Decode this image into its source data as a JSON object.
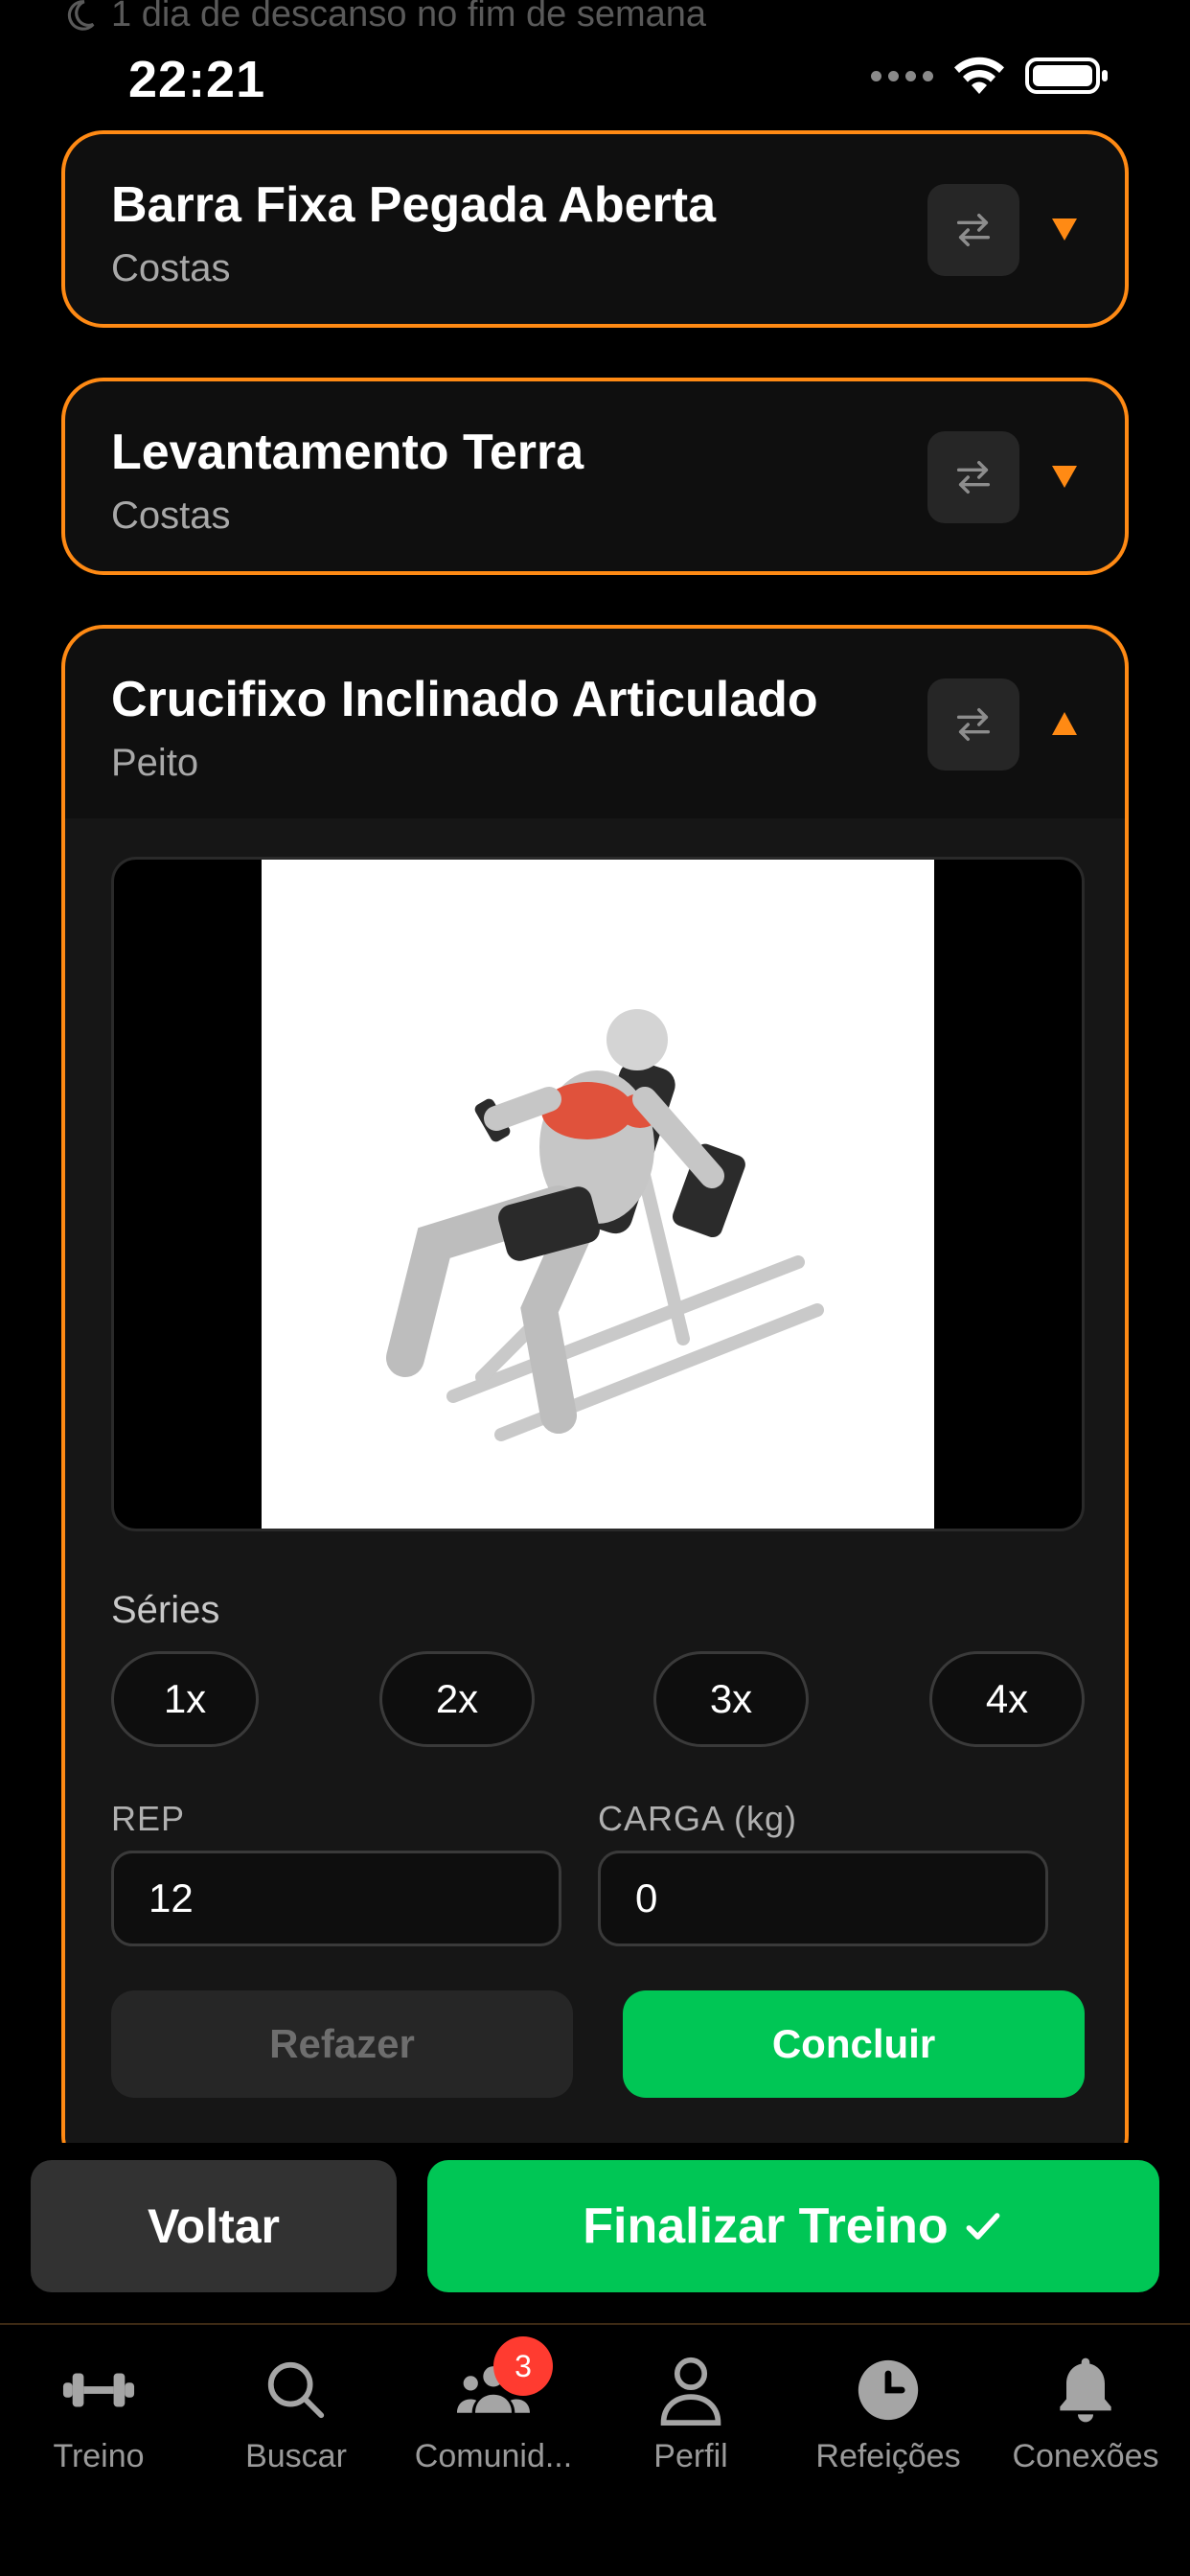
{
  "status_bar": {
    "rest_note": "1 dia de descanso no fim de semana",
    "time": "22:21"
  },
  "exercises": [
    {
      "name": "Barra Fixa Pegada Aberta",
      "muscle": "Costas",
      "expanded": false
    },
    {
      "name": "Levantamento Terra",
      "muscle": "Costas",
      "expanded": false
    },
    {
      "name": "Crucifixo Inclinado Articulado",
      "muscle": "Peito",
      "expanded": true
    }
  ],
  "detail": {
    "image": "incline-chest-fly-machine-illustration",
    "series_label": "Séries",
    "series_options": [
      "1x",
      "2x",
      "3x",
      "4x"
    ],
    "rep_label": "REP",
    "rep_value": "12",
    "load_label": "CARGA (kg)",
    "load_value": "0",
    "redo_label": "Refazer",
    "done_label": "Concluir"
  },
  "footer": {
    "back_label": "Voltar",
    "finish_label": "Finalizar Treino",
    "finish_icon": "checkmark-icon"
  },
  "tabbar": {
    "items": [
      {
        "label": "Treino",
        "icon": "dumbbell-icon"
      },
      {
        "label": "Buscar",
        "icon": "search-icon"
      },
      {
        "label": "Comunid...",
        "icon": "community-icon",
        "badge": "3"
      },
      {
        "label": "Perfil",
        "icon": "person-icon"
      },
      {
        "label": "Refeições",
        "icon": "clock-icon"
      },
      {
        "label": "Conexões",
        "icon": "bell-icon"
      }
    ]
  },
  "colors": {
    "accent": "#ff8a14",
    "success": "#00c655",
    "badge": "#ff3b30"
  }
}
